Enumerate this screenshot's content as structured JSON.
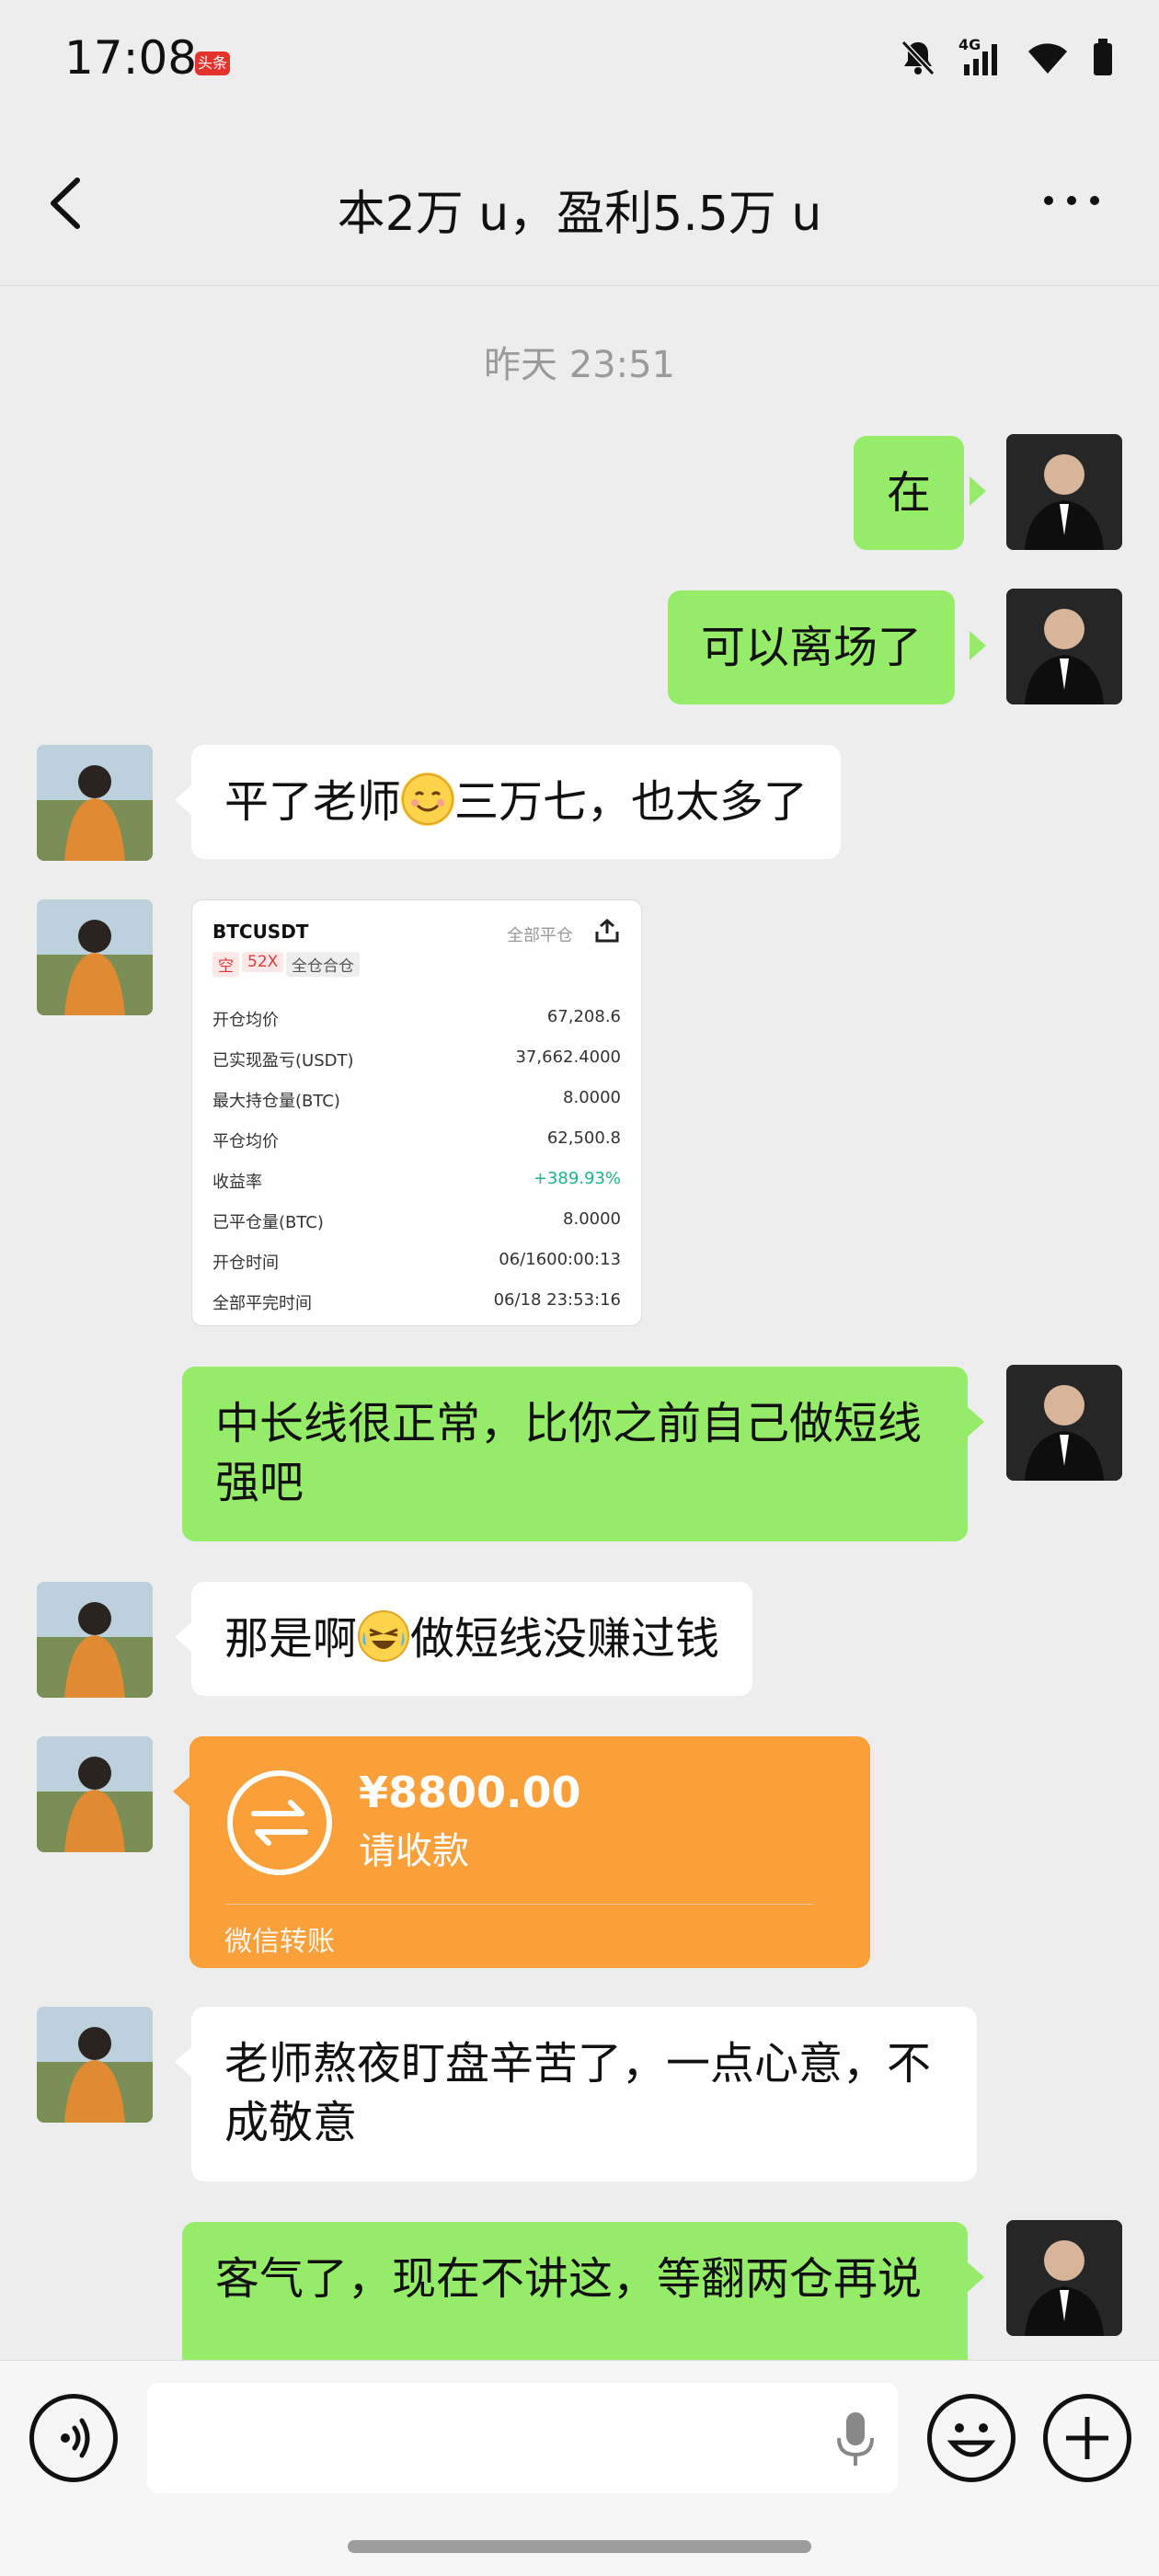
{
  "status_bar": {
    "time": "17:08",
    "badge": "头条"
  },
  "nav": {
    "title": "本2万 u，盈利5.5万 u"
  },
  "timestamp": "昨天 23:51",
  "messages": {
    "m1": "在",
    "m2": "可以离场了",
    "m3a": "平了老师",
    "m3b": "三万七，也太多了",
    "m5": "中长线很正常，比你之前自己做短线强吧",
    "m6a": "那是啊",
    "m6b": "做短线没赚过钱",
    "m8": "老师熬夜盯盘辛苦了，一点心意，不成敬意",
    "m9": "客气了，现在不讲这，等翻两仓再说"
  },
  "trade_card": {
    "symbol": "BTCUSDT",
    "action": "全部平仓",
    "tags": [
      "空",
      "52X",
      "全仓合仓"
    ],
    "rows": [
      {
        "k": "开仓均价",
        "v": "67,208.6"
      },
      {
        "k": "已实现盈亏(USDT)",
        "v": "37,662.4000"
      },
      {
        "k": "最大持仓量(BTC)",
        "v": "8.0000"
      },
      {
        "k": "平仓均价",
        "v": "62,500.8"
      },
      {
        "k": "收益率",
        "v": "+389.93%"
      },
      {
        "k": "已平仓量(BTC)",
        "v": "8.0000"
      },
      {
        "k": "开仓时间",
        "v": "06/1600:00:13"
      },
      {
        "k": "全部平完时间",
        "v": "06/18 23:53:16"
      }
    ]
  },
  "transfer": {
    "amount": "¥8800.00",
    "label": "请收款",
    "footer": "微信转账"
  },
  "colors": {
    "green_bubble": "#95ec69",
    "transfer_orange": "#f9a03a",
    "profit_green": "#1bb486"
  }
}
